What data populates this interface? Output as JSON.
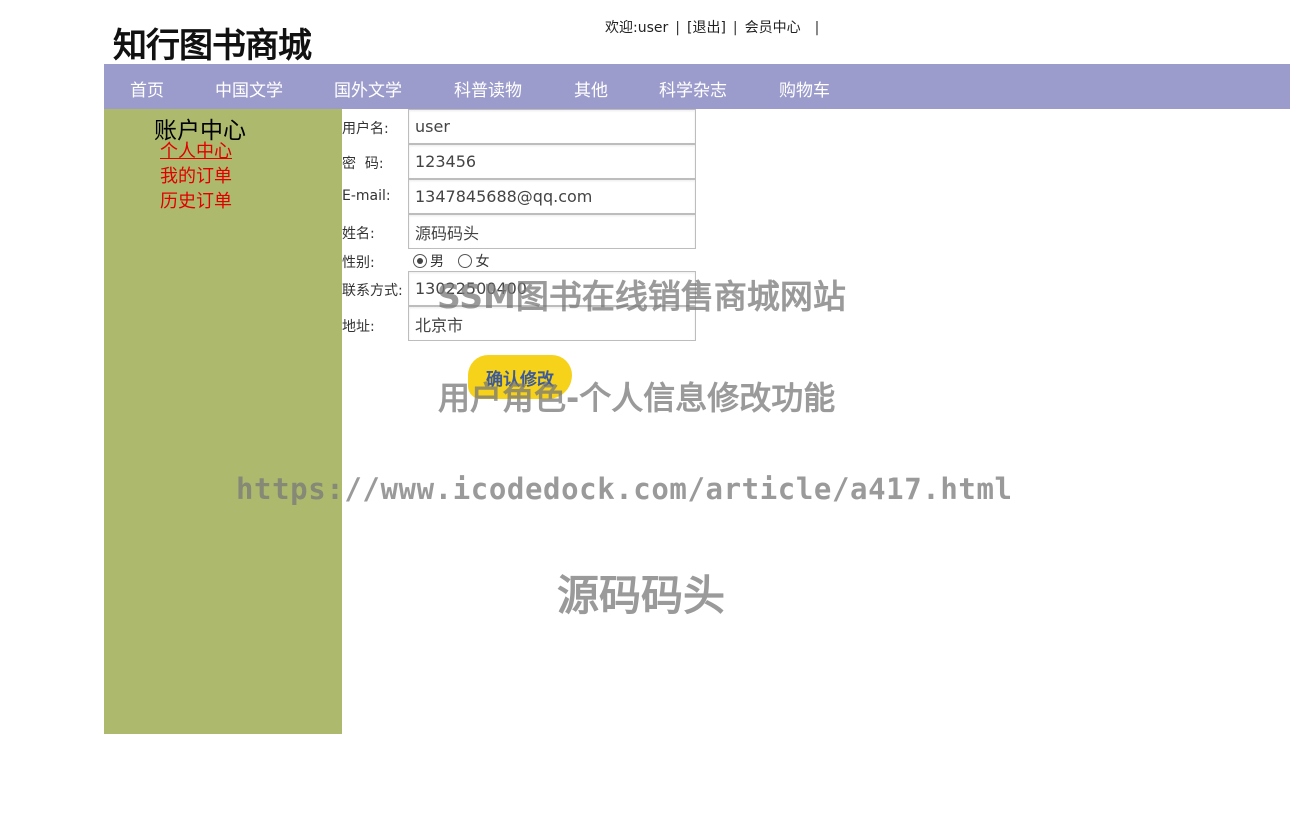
{
  "header": {
    "logo": "知行图书商城",
    "welcome": "欢迎:user",
    "logout": "[退出]",
    "member_center": "会员中心",
    "sep": "|"
  },
  "nav": {
    "items": [
      {
        "label": "首页"
      },
      {
        "label": "中国文学"
      },
      {
        "label": "国外文学"
      },
      {
        "label": "科普读物"
      },
      {
        "label": "其他"
      },
      {
        "label": "科学杂志"
      },
      {
        "label": "购物车"
      }
    ]
  },
  "sidebar": {
    "title": "账户中心",
    "links": [
      {
        "label": "个人中心"
      },
      {
        "label": "我的订单"
      },
      {
        "label": "历史订单"
      }
    ]
  },
  "form": {
    "username": {
      "label": "用户名:",
      "value": "user"
    },
    "password": {
      "label": "密  码:",
      "value": "123456"
    },
    "email": {
      "label": "E-mail:",
      "value": "1347845688@qq.com"
    },
    "name": {
      "label": "姓名:",
      "value": "源码码头"
    },
    "gender": {
      "label": "性别:",
      "male": "男",
      "female": "女",
      "selected": "男"
    },
    "phone": {
      "label": "联系方式:",
      "value": "13022500400"
    },
    "address": {
      "label": "地址:",
      "value": "北京市"
    },
    "submit": "确认修改"
  },
  "watermark": {
    "line1": "SSM图书在线销售商城网站",
    "line2": "用户角色-个人信息修改功能",
    "line3": "https://www.icodedock.com/article/a417.html",
    "line4": "源码码头"
  }
}
